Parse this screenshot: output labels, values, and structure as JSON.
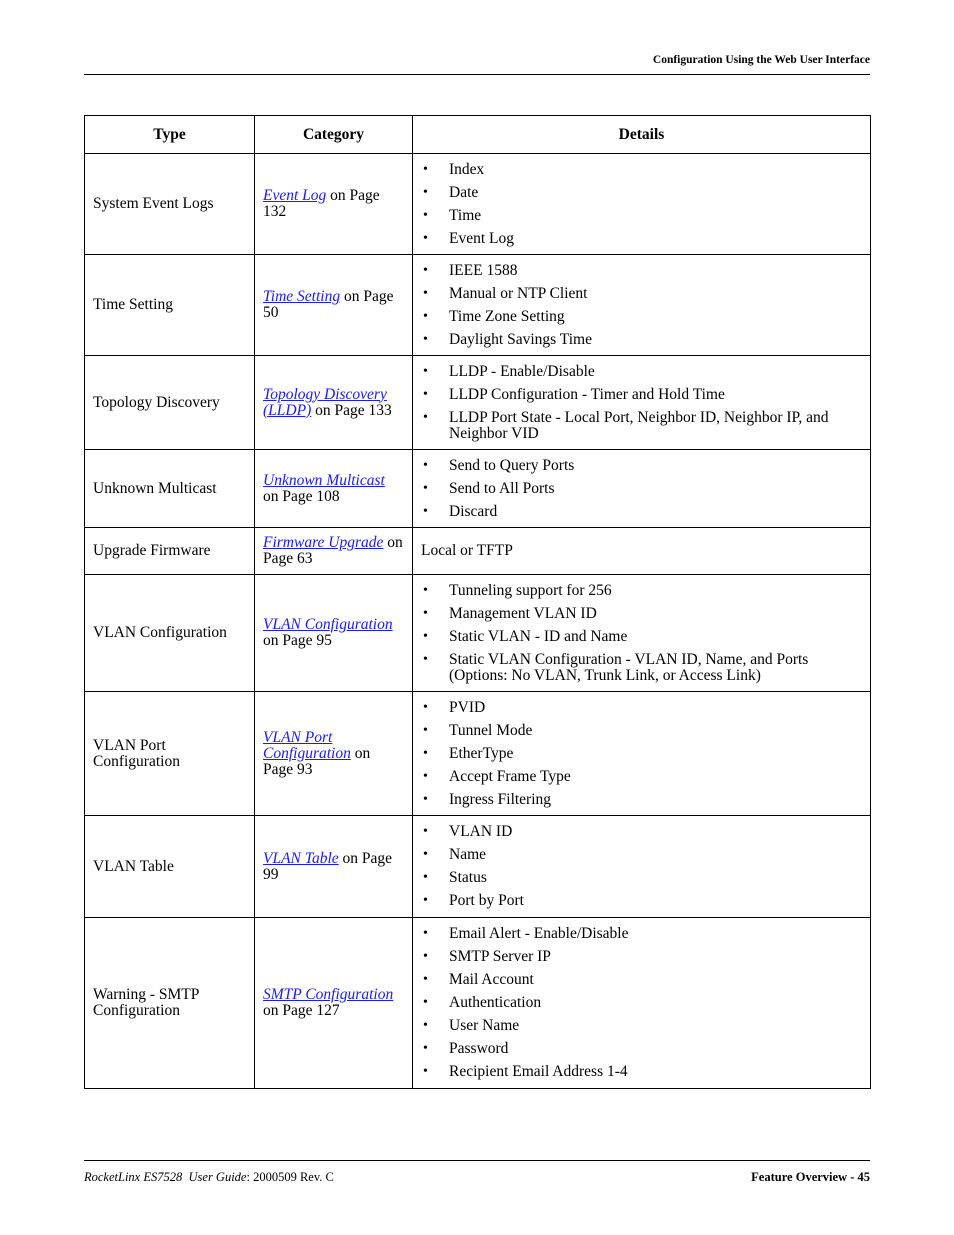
{
  "header": {
    "section_title": "Configuration Using the Web User Interface"
  },
  "table": {
    "columns": [
      "Type",
      "Category",
      "Details"
    ],
    "rows": [
      {
        "type": "System Event Logs",
        "category_link": "Event Log",
        "category_suffix": " on Page 132",
        "details": [
          "Index",
          "Date",
          "Time",
          "Event Log"
        ]
      },
      {
        "type": "Time Setting",
        "category_link": "Time Setting",
        "category_suffix": " on Page 50",
        "details": [
          "IEEE 1588",
          "Manual or NTP Client",
          "Time Zone Setting",
          "Daylight Savings Time"
        ]
      },
      {
        "type": "Topology Discovery",
        "category_link": "Topology Discovery (LLDP)",
        "category_suffix": " on Page 133",
        "details": [
          "LLDP - Enable/Disable",
          "LLDP Configuration - Timer and Hold Time",
          "LLDP Port State - Local Port, Neighbor ID, Neighbor IP, and Neighbor VID"
        ]
      },
      {
        "type": "Unknown Multicast",
        "category_link": "Unknown Multicast",
        "category_suffix": " on Page 108",
        "details": [
          "Send to Query Ports",
          "Send to All Ports",
          "Discard"
        ]
      },
      {
        "type": "Upgrade Firmware",
        "category_link": "Firmware Upgrade",
        "category_suffix": " on Page 63",
        "details_text": "Local or TFTP"
      },
      {
        "type": "VLAN Configuration",
        "category_link": "VLAN Configuration",
        "category_suffix": " on Page 95",
        "details": [
          "Tunneling support for 256",
          "Management VLAN ID",
          "Static VLAN - ID and Name",
          "Static VLAN Configuration - VLAN ID, Name, and Ports (Options: No VLAN, Trunk Link, or Access Link)"
        ]
      },
      {
        "type": "VLAN Port Configuration",
        "category_link": "VLAN Port Configuration",
        "category_suffix": " on Page 93",
        "details": [
          "PVID",
          "Tunnel Mode",
          "EtherType",
          "Accept Frame Type",
          "Ingress Filtering"
        ]
      },
      {
        "type": "VLAN Table",
        "category_link": "VLAN Table",
        "category_suffix": " on Page 99",
        "details": [
          "VLAN ID",
          "Name",
          "Status",
          "Port by Port"
        ]
      },
      {
        "type": "Warning - SMTP Configuration",
        "category_link": "SMTP Configuration",
        "category_suffix": " on Page 127",
        "details": [
          "Email Alert - Enable/Disable",
          "SMTP Server IP",
          "Mail Account",
          "Authentication",
          "User Name",
          "Password",
          "Recipient Email Address 1-4"
        ]
      }
    ]
  },
  "footer": {
    "product": "RocketLinx ES7528",
    "guide_label": "User Guide",
    "doc_number": ": 2000509 Rev. C",
    "page_label": "Feature Overview - 45"
  },
  "colors": {
    "link": "#1a1aff",
    "text": "#000000"
  }
}
